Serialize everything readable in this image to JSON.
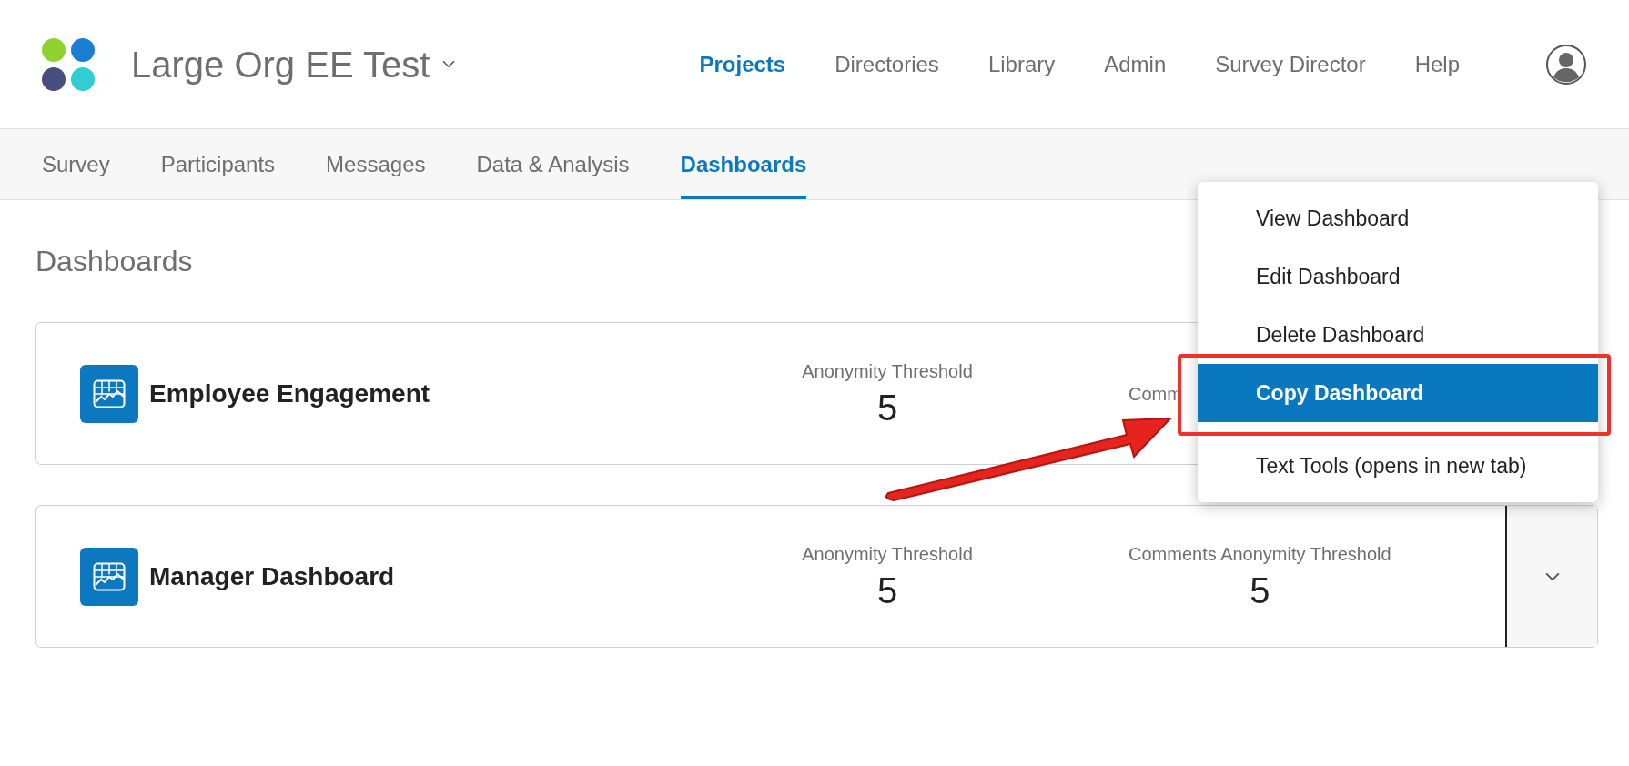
{
  "header": {
    "project_title": "Large Org EE Test",
    "nav": [
      {
        "label": "Projects",
        "selected": true
      },
      {
        "label": "Directories",
        "selected": false
      },
      {
        "label": "Library",
        "selected": false
      },
      {
        "label": "Admin",
        "selected": false
      },
      {
        "label": "Survey Director",
        "selected": false
      },
      {
        "label": "Help",
        "selected": false
      }
    ]
  },
  "tabs": [
    {
      "label": "Survey",
      "selected": false
    },
    {
      "label": "Participants",
      "selected": false
    },
    {
      "label": "Messages",
      "selected": false
    },
    {
      "label": "Data & Analysis",
      "selected": false
    },
    {
      "label": "Dashboards",
      "selected": true
    }
  ],
  "page_title": "Dashboards",
  "dashboards": [
    {
      "name": "Employee Engagement",
      "stats": [
        {
          "label": "Anonymity Threshold",
          "value": "5"
        },
        {
          "label": "Comm"
        }
      ]
    },
    {
      "name": "Manager Dashboard",
      "stats": [
        {
          "label": "Anonymity Threshold",
          "value": "5"
        },
        {
          "label": "Comments Anonymity Threshold",
          "value": "5"
        }
      ]
    }
  ],
  "menu": {
    "items": [
      {
        "label": "View Dashboard",
        "selected": false
      },
      {
        "label": "Edit Dashboard",
        "selected": false
      },
      {
        "label": "Delete Dashboard",
        "selected": false
      },
      {
        "label": "Copy Dashboard",
        "selected": true
      },
      {
        "label": "Text Tools (opens in new tab)",
        "selected": false
      }
    ]
  }
}
